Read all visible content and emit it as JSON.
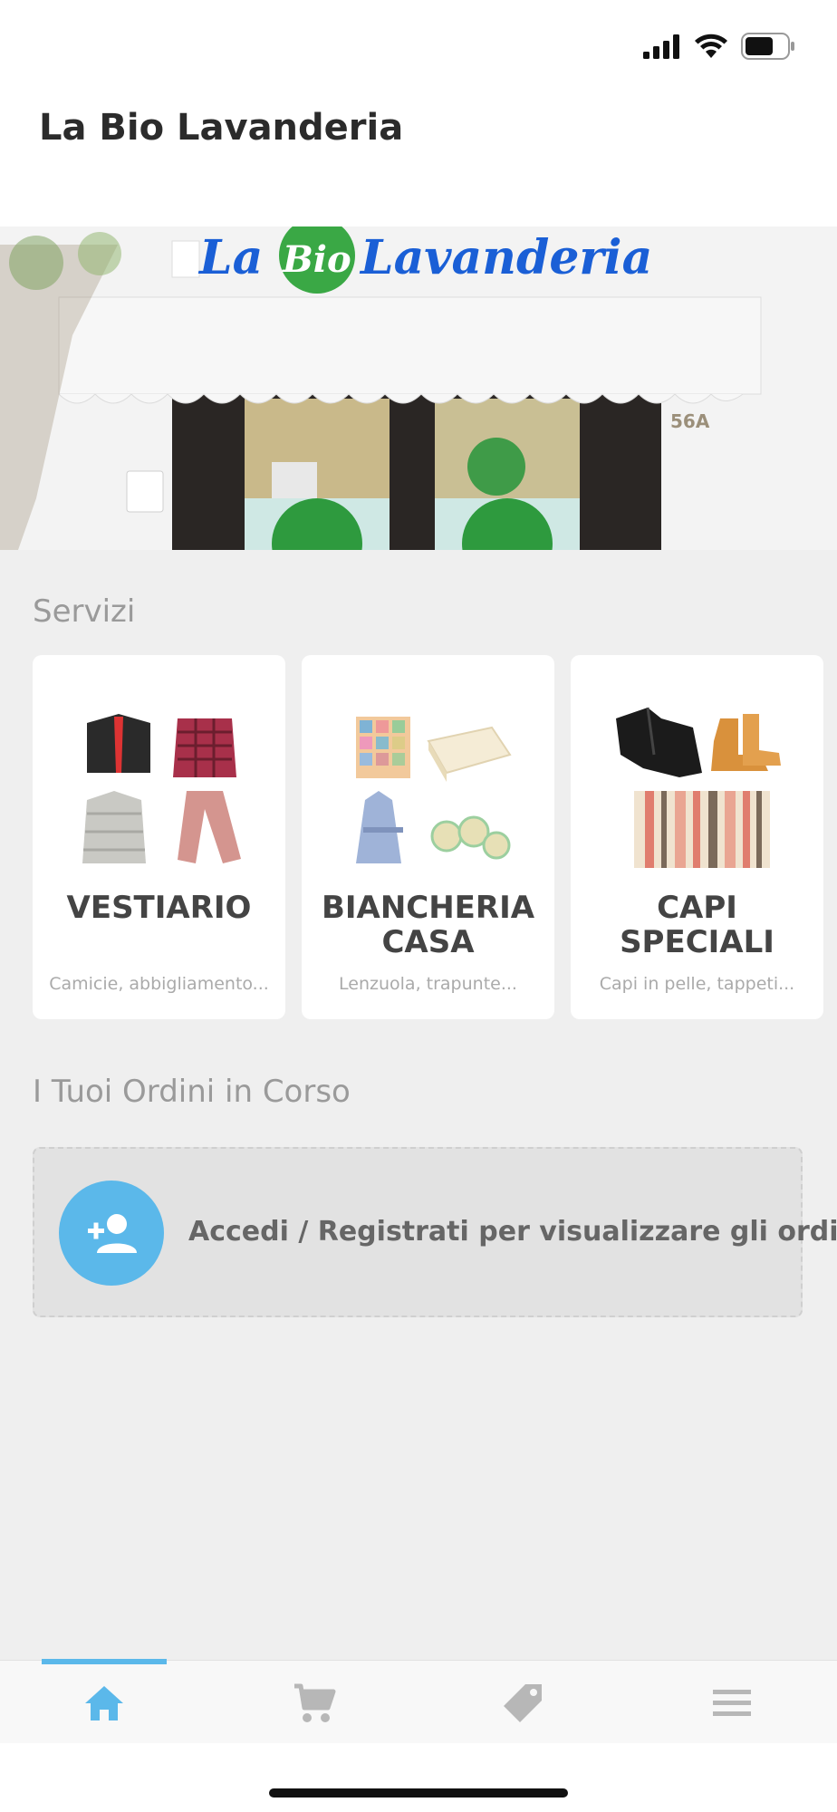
{
  "app": {
    "title": "La Bio Lavanderia"
  },
  "hero": {
    "sign_la": "La",
    "sign_bio": "Bio",
    "sign_lavanderia": "Lavanderia",
    "number": "56A"
  },
  "services": {
    "title": "Servizi",
    "items": [
      {
        "title": "VESTIARIO",
        "subtitle": "Camicie, abbigliamento..."
      },
      {
        "title": "BIANCHERIA\nCASA",
        "subtitle": "Lenzuola, trapunte..."
      },
      {
        "title": "CAPI\nSPECIALI",
        "subtitle": "Capi in pelle, tappeti..."
      }
    ]
  },
  "orders": {
    "title": "I Tuoi Ordini in Corso",
    "login_text": "Accedi / Registrati per visualizzare gli ordini"
  },
  "nav": {
    "items": [
      "home-icon",
      "cart-icon",
      "tag-icon",
      "menu-icon"
    ],
    "active": 0
  },
  "colors": {
    "accent": "#5bb8ea",
    "background": "#efefef",
    "sign_blue": "#1a5fd6",
    "sign_green": "#3aa845"
  }
}
